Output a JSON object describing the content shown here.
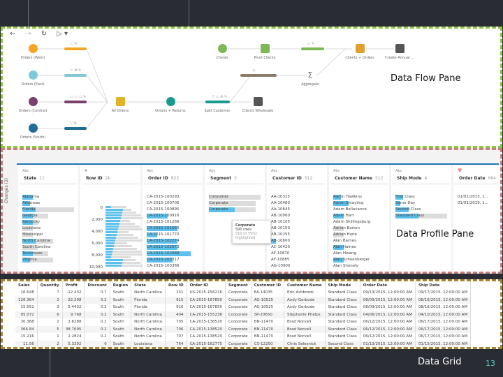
{
  "slide": {
    "flow_label": "Data Flow Pane",
    "profile_label": "Data Profile  Pane",
    "grid_label": "Data Grid",
    "page_number": "13"
  },
  "flow": {
    "toolbar": {
      "back": "←",
      "forward": "→",
      "refresh": "↻",
      "run": "▷ ▾"
    },
    "nodes": [
      {
        "label": "Orders (West)",
        "color": "#f5a623"
      },
      {
        "label": "Orders (East)",
        "color": "#7ec8d8"
      },
      {
        "label": "Orders (Central)",
        "color": "#7b3f6e"
      },
      {
        "label": "Orders (South)",
        "color": "#1f6e96"
      },
      {
        "label": "All Orders",
        "color": "#e0b429"
      },
      {
        "label": "Orders + Returns",
        "color": "#1a9a8f"
      },
      {
        "label": "Split Customer",
        "color": "#1a9a8f"
      },
      {
        "label": "Clients",
        "color": "#7cb956"
      },
      {
        "label": "Pivot Clients",
        "color": "#7cb956"
      },
      {
        "label": "Aggregate",
        "color": "#666"
      },
      {
        "label": "Clients + Orders",
        "color": "#e0a030"
      },
      {
        "label": "Create Annual ...",
        "color": "#555"
      },
      {
        "label": "Clients Wholesale",
        "color": "#555"
      }
    ],
    "step_bars": [
      {
        "icons": "▭ ✎",
        "color": "#f5a623"
      },
      {
        "icons": "▭ ⊘ ✎",
        "color": "#7ec8d8"
      },
      {
        "icons": "▭ ▭ ▭ ✎",
        "color": "#7b3f6e"
      },
      {
        "icons": "▽ ⊘",
        "color": "#1f6e96"
      },
      {
        "icons": "▽ ▭ ⊘ ✎",
        "color": "#1a9a8f"
      },
      {
        "icons": "▭ ✎",
        "color": "#7cb956"
      },
      {
        "icons": "▷",
        "color": "#8a7a6a"
      }
    ]
  },
  "profile": {
    "changes": "Changes (2)",
    "columns": [
      {
        "type": "Abc",
        "name": "State",
        "count": "11",
        "values": [
          [
            "Alabama",
            0.2,
            0
          ],
          [
            "Arkansas",
            0.15,
            0
          ],
          [
            "Florida",
            0.25,
            1
          ],
          [
            "Georgia",
            0.2,
            0.5
          ],
          [
            "Kentucky",
            0.2,
            0.3
          ],
          [
            "Louisiana",
            0,
            0.2
          ],
          [
            "Mississippi",
            0,
            0.2
          ],
          [
            "North Carolina",
            0.25,
            0.6
          ],
          [
            "South Carolina",
            0,
            0.3
          ],
          [
            "Tennessee",
            0.2,
            0.5
          ],
          [
            "Virginia",
            0.15,
            0.6
          ]
        ]
      },
      {
        "type": "#",
        "name": "Row ID",
        "count": "2k",
        "axis": [
          "0",
          "2,000",
          "4,000",
          "6,000",
          "8,000",
          "10,000"
        ]
      },
      {
        "type": "Abc",
        "name": "Order ID",
        "count": "822",
        "values": [
          [
            "CA-2015-100293",
            0,
            0
          ],
          [
            "CA-2015-100706",
            0,
            0
          ],
          [
            "CA-2015-100895",
            0,
            0
          ],
          [
            "CA-2015-100916",
            0.4,
            0.4
          ],
          [
            "CA-2015-101266",
            0,
            0
          ],
          [
            "CA-2015-101560",
            0.6,
            0.6
          ],
          [
            "CA-2015-101770",
            0.2,
            0.2
          ],
          [
            "CA-2015-102274",
            0.6,
            0.6
          ],
          [
            "CA-2015-102673",
            0.6,
            0.6
          ],
          [
            "CA-2015-102988",
            0.85,
            0.85
          ],
          [
            "CA-2015-103317",
            0.5,
            0.5
          ],
          [
            "CA-2015-103366",
            0,
            0
          ]
        ]
      },
      {
        "type": "Abc",
        "name": "Segment",
        "count": "3",
        "values": [
          [
            "Consumer",
            0,
            1
          ],
          [
            "Corporate",
            0,
            0.9
          ],
          [
            "Corporate",
            0.5,
            0.9
          ]
        ]
      },
      {
        "type": "Abc",
        "name": "Customer ID",
        "count": "512",
        "values": [
          [
            "AA-10315",
            0,
            0
          ],
          [
            "AA-10480",
            0,
            0
          ],
          [
            "AA-10645",
            0,
            0
          ],
          [
            "AB-10060",
            0,
            0
          ],
          [
            "AB-10105",
            0,
            0
          ],
          [
            "AB-10150",
            0,
            0
          ],
          [
            "AB-10255",
            0,
            0
          ],
          [
            "AB-10600",
            0.1,
            0.1
          ],
          [
            "AC-10420",
            0,
            0
          ],
          [
            "AF-10870",
            0,
            0
          ],
          [
            "AF-10885",
            0,
            0
          ],
          [
            "AG-10900",
            0,
            0
          ]
        ]
      },
      {
        "type": "Abc",
        "name": "Customer Name",
        "count": "512",
        "values": [
          [
            "Aaron Hawkins",
            0.15,
            0.15
          ],
          [
            "Aaron Smayling",
            0.3,
            0.3
          ],
          [
            "Adam Bellavance",
            0,
            0
          ],
          [
            "Adam Hart",
            0.2,
            0.2
          ],
          [
            "Adam Shillingsburg",
            0,
            0
          ],
          [
            "Adrian Barton",
            0,
            0.2
          ],
          [
            "Adrian Hane",
            0,
            0.2
          ],
          [
            "Alan Barnes",
            0,
            0
          ],
          [
            "Alan Haines",
            0.2,
            0.2
          ],
          [
            "Alan Hwang",
            0,
            0
          ],
          [
            "Alan Schoenberger",
            0.2,
            0.2
          ],
          [
            "Alan Shonely",
            0,
            0
          ]
        ]
      },
      {
        "type": "Abc",
        "name": "Ship Mode",
        "count": "4",
        "values": [
          [
            "First Class",
            0.15,
            0.15
          ],
          [
            "Same Day",
            0.1,
            0.1
          ],
          [
            "Second Class",
            0.25,
            0.25
          ],
          [
            "Standard Class",
            0.45,
            1
          ]
        ]
      },
      {
        "type": "📅",
        "name": "Order Date",
        "count": "684",
        "values": [
          [
            "01/01/2015, 1...",
            0,
            0
          ],
          [
            "01/01/2019, 1...",
            0,
            0
          ]
        ]
      }
    ],
    "tooltip": {
      "title": "Corporate",
      "rows": "590 rows",
      "note": "510 (0.59%) highlighted"
    }
  },
  "grid": {
    "headers": [
      "Sales",
      "Quantity",
      "Profit",
      "Discount",
      "Region",
      "State",
      "Row ID",
      "Order ID",
      "Segment",
      "Customer ID",
      "Customer Name",
      "Ship Mode",
      "Order Date",
      "Ship Date"
    ],
    "rows": [
      [
        "16.648",
        "7",
        "-12.432",
        "0.7",
        "South",
        "North Carolina",
        "231",
        "US-2015-156216",
        "Corporate",
        "EA-14035",
        "Erin Ashbrook",
        "Standard Class",
        "09/13/2015, 12:00:00 AM",
        "09/17/2015, 12:00:00 AM"
      ],
      [
        "126.364",
        "2",
        "22.298",
        "0.2",
        "South",
        "Florida",
        "915",
        "CA-2015-167850",
        "Corporate",
        "AG-10525",
        "Andy Gerbode",
        "Standard Class",
        "08/09/2015, 12:00:00 AM",
        "08/16/2015, 12:00:00 AM"
      ],
      [
        "15.552",
        "3",
        "5.4432",
        "0.2",
        "South",
        "Florida",
        "916",
        "CA-2015-167850",
        "Corporate",
        "AG-10525",
        "Andy Gerbode",
        "Standard Class",
        "08/09/2015, 12:00:00 AM",
        "08/16/2015, 12:00:00 AM"
      ],
      [
        "95.072",
        "6",
        "9.768",
        "0.2",
        "South",
        "North Carolina",
        "404",
        "CA-2015-155236",
        "Corporate",
        "SP-20650",
        "Stephanie Phelps",
        "Standard Class",
        "04/06/2015, 12:00:00 AM",
        "04/10/2015, 12:00:00 AM"
      ],
      [
        "30.368",
        "2",
        "3.6288",
        "0.2",
        "South",
        "North Carolina",
        "705",
        "CA-2015-138520",
        "Corporate",
        "BN-11470",
        "Brad Norvell",
        "Standard Class",
        "06/12/2015, 12:00:00 AM",
        "06/17/2015, 12:00:00 AM"
      ],
      [
        "366.84",
        "5",
        "38.7695",
        "0.2",
        "South",
        "North Carolina",
        "706",
        "CA-2015-138520",
        "Corporate",
        "BN-11470",
        "Brad Norvell",
        "Standard Class",
        "06/12/2015, 12:00:00 AM",
        "06/17/2015, 12:00:00 AM"
      ],
      [
        "15.216",
        "1",
        "2.2824",
        "0.2",
        "South",
        "North Carolina",
        "707",
        "CA-2015-138520",
        "Corporate",
        "BN-11470",
        "Brad Norvell",
        "Standard Class",
        "06/12/2015, 12:00:00 AM",
        "06/17/2015, 12:00:00 AM"
      ],
      [
        "11.56",
        "2",
        "5.3392",
        "0",
        "South",
        "Louisiana",
        "764",
        "CA-2015-162775",
        "Corporate",
        "CS-12250",
        "Chris Selesnick",
        "Second Class",
        "01/13/2015, 12:00:00 AM",
        "01/15/2015, 12:00:00 AM"
      ]
    ]
  }
}
